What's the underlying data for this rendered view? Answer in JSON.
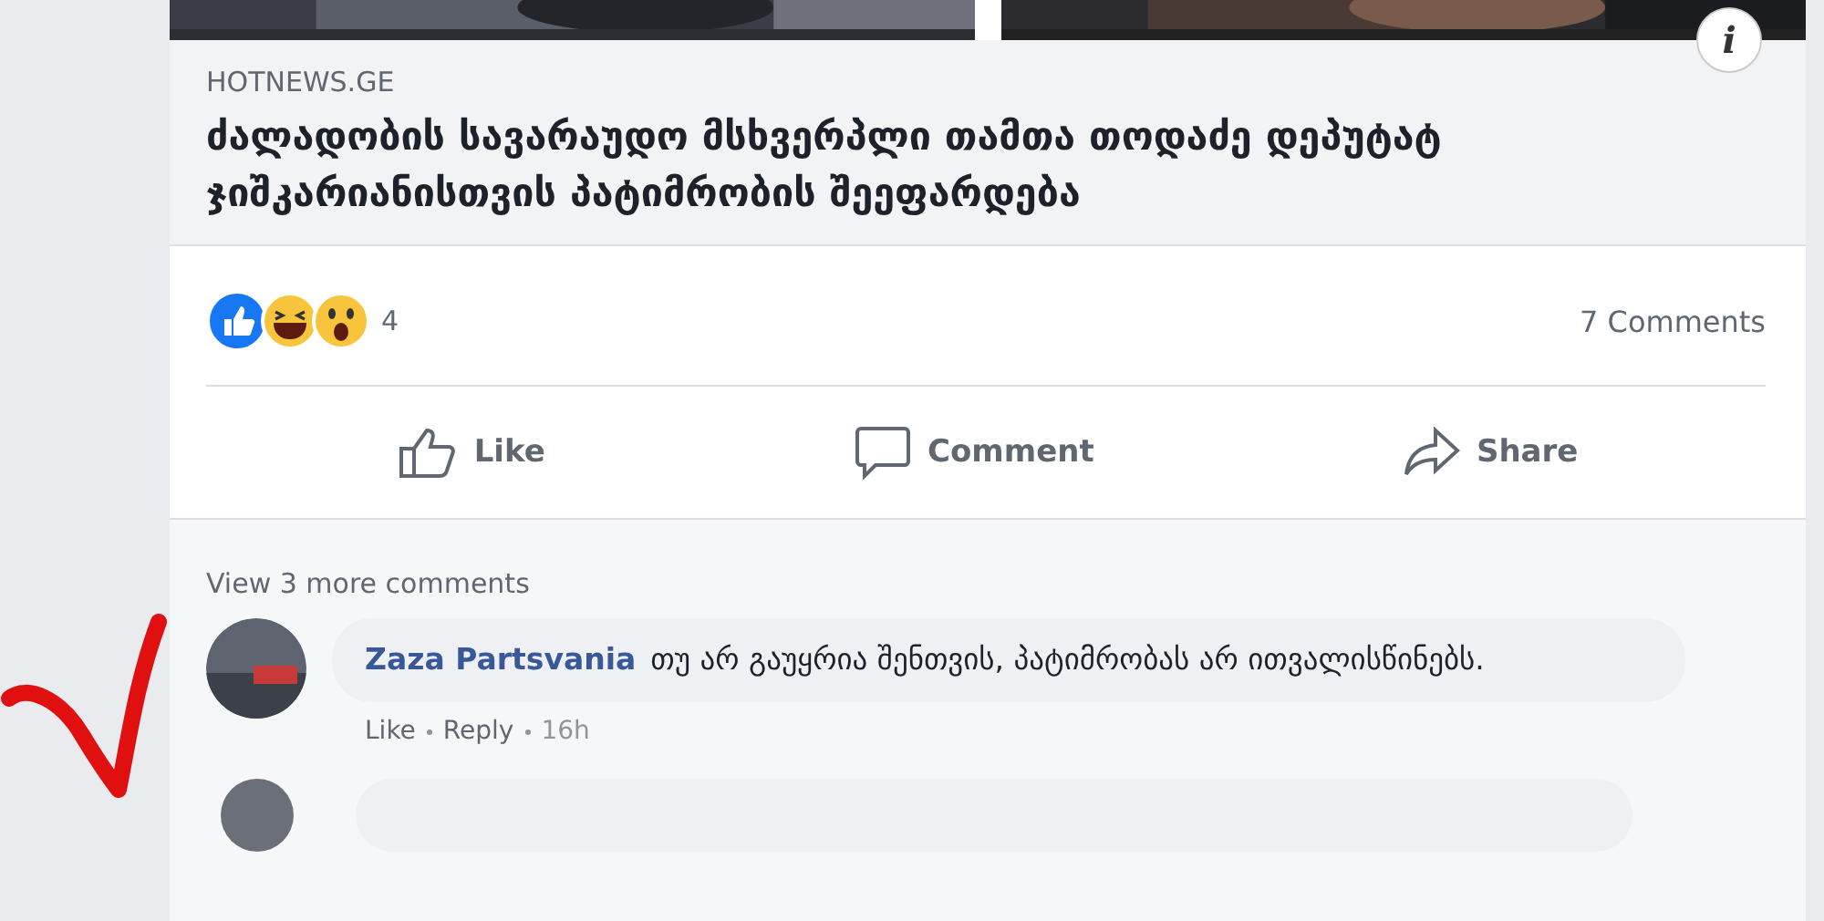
{
  "link_preview": {
    "source": "HOTNEWS.GE",
    "headline": "ძალადობის სავარაუდო მსხვერპლი თამთა თოდაძე დეპუტატ ჯიშკარიანისთვის პატიმრობის შეეფარდება",
    "info_button": "i"
  },
  "reactions": {
    "icons": [
      {
        "kind": "like"
      },
      {
        "kind": "haha"
      },
      {
        "kind": "wow"
      }
    ],
    "count": "4",
    "comments": "7 Comments"
  },
  "actions": [
    {
      "kind": "like",
      "label": "Like"
    },
    {
      "kind": "comment",
      "label": "Comment"
    },
    {
      "kind": "share",
      "label": "Share"
    }
  ],
  "view_more": "View 3 more comments",
  "comments": [
    {
      "author": "Zaza Partsvania",
      "text": "თუ არ გაუყრია შენთვის, პატიმრობას არ ითვალისწინებს.",
      "links": [
        "Like",
        "Reply"
      ],
      "time": "16h"
    }
  ]
}
